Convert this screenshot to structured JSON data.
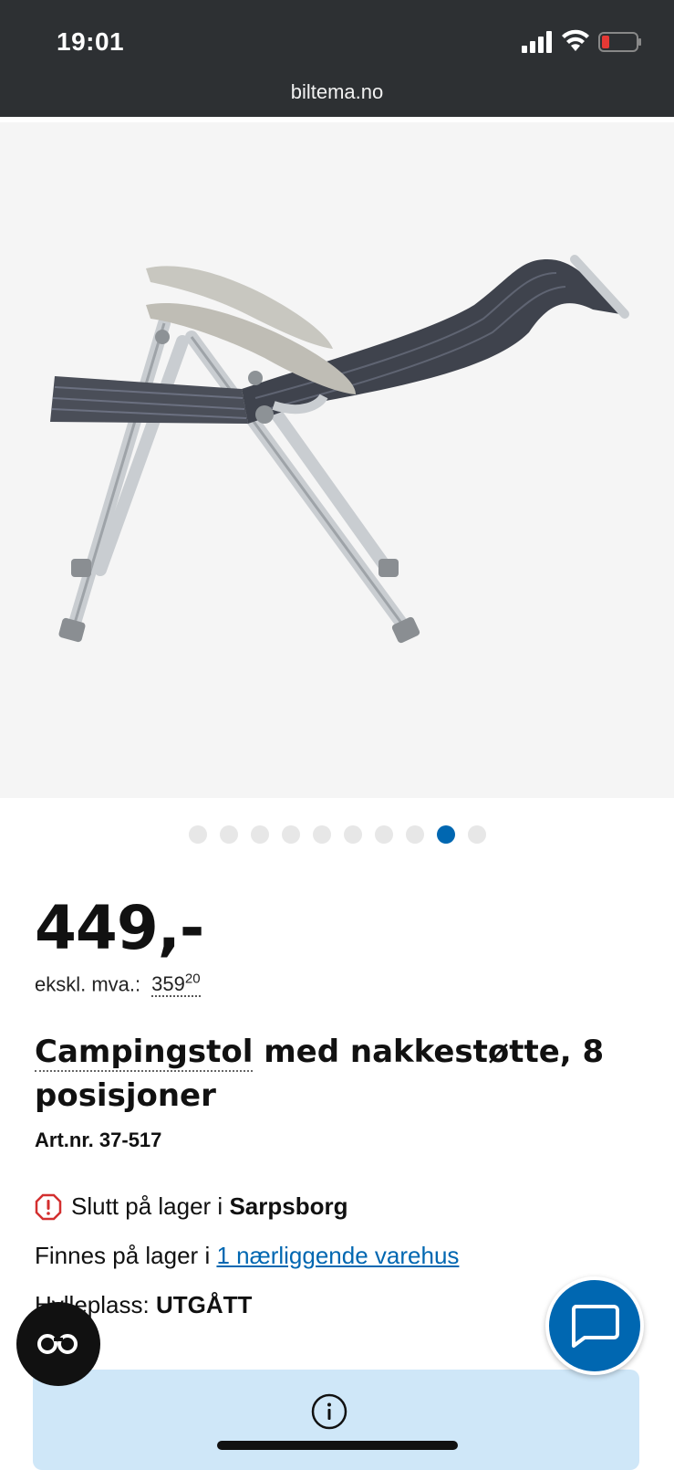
{
  "status": {
    "time": "19:01",
    "url": "biltema.no"
  },
  "gallery": {
    "image_alt": "Campingstol med nakkestøtte",
    "dot_count": 10,
    "active_index": 8,
    "accent": "#0067b1"
  },
  "product": {
    "price": "449,-",
    "ex_vat_label": "ekskl. mva.:",
    "ex_vat_whole": "359",
    "ex_vat_cents": "20",
    "title_part1": "Campingstol",
    "title_part2": " med nakkestøtte, 8 posisjoner",
    "art_nr": "Art.nr. 37-517"
  },
  "stock": {
    "out_prefix": "Slutt på lager i ",
    "store": "Sarpsborg",
    "near_prefix": "Finnes på lager i ",
    "near_link": "1 nærliggende varehus",
    "shelf_label": "Hylleplass: ",
    "shelf_value": "UTGÅTT"
  },
  "icons": {
    "info": "info-icon",
    "chat": "chat-icon",
    "glasses": "glasses-icon",
    "warning": "warning-icon"
  }
}
